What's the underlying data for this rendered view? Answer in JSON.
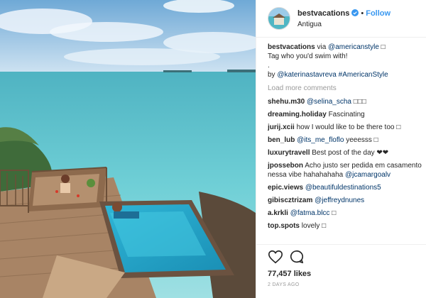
{
  "header": {
    "username": "bestvacations",
    "separator": "•",
    "follow_label": "Follow",
    "location": "Antigua"
  },
  "caption": {
    "username": "bestvacations",
    "line1_text": " via ",
    "line1_mention": "@americanstyle",
    "line1_emoji": "□",
    "line2": "Tag who you'd swim with!",
    "line3": ".",
    "line4_prefix": "by ",
    "line4_mention": "@katerinastavreva",
    "line4_hashtag": "#AmericanStyle"
  },
  "load_more": "Load more comments",
  "comments": [
    {
      "user": "shehu.m30",
      "text": "",
      "mention": "@selina_scha",
      "suffix": " □□□"
    },
    {
      "user": "dreaming.holiday",
      "text": " Fascinating",
      "mention": "",
      "suffix": ""
    },
    {
      "user": "jurij.xcii",
      "text": " how I would like to be there too □",
      "mention": "",
      "suffix": ""
    },
    {
      "user": "ben_lub",
      "text": "",
      "mention": "@its_me_floflo",
      "suffix": " yeeesss □"
    },
    {
      "user": "luxurytravell",
      "text": " Best post of the day ❤❤",
      "mention": "",
      "suffix": ""
    },
    {
      "user": "jpossebon",
      "text": " Acho justo ser pedida em casamento nessa vibe hahahahaha ",
      "mention": "@jcamargoalv",
      "suffix": ""
    },
    {
      "user": "epic.views",
      "text": "",
      "mention": "@beautifuldestinations5",
      "suffix": ""
    },
    {
      "user": "gibiscztrizam",
      "text": "",
      "mention": "@jeffreydnunes",
      "suffix": ""
    },
    {
      "user": "a.krkli",
      "text": "",
      "mention": "@fatma.blcc",
      "suffix": " □"
    },
    {
      "user": "top.spots",
      "text": " lovely □",
      "mention": "",
      "suffix": ""
    }
  ],
  "likes": "77,457 likes",
  "time_ago": "2 DAYS AGO",
  "icons": [
    "heart-icon",
    "comment-icon"
  ],
  "colors": {
    "follow": "#3897f0",
    "link": "#003569",
    "muted": "#999999",
    "text": "#262626"
  }
}
